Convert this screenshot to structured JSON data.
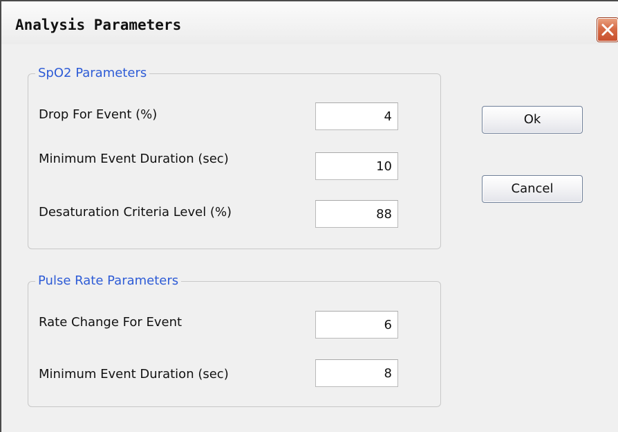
{
  "window": {
    "title": "Analysis Parameters",
    "close_icon": "close-icon"
  },
  "spo2": {
    "title": "SpO2 Parameters",
    "fields": [
      {
        "label": "Drop For Event (%)",
        "value": "4"
      },
      {
        "label": "Minimum Event Duration (sec)",
        "value": "10"
      },
      {
        "label": "Desaturation Criteria Level (%)",
        "value": "88"
      }
    ]
  },
  "pulse": {
    "title": "Pulse Rate Parameters",
    "fields": [
      {
        "label": "Rate Change For Event",
        "value": "6"
      },
      {
        "label": "Minimum Event Duration (sec)",
        "value": "8"
      }
    ]
  },
  "buttons": {
    "ok": "Ok",
    "cancel": "Cancel"
  },
  "colors": {
    "group_title": "#2d5bd6",
    "close_button": "#d66b46"
  }
}
